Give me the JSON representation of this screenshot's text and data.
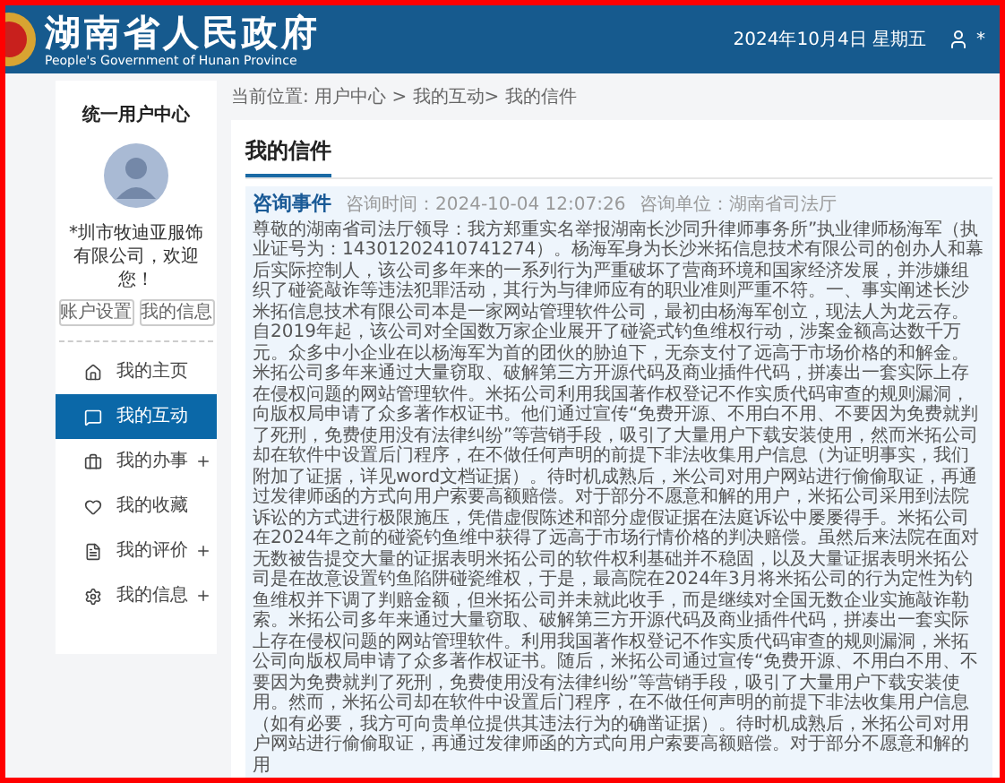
{
  "header": {
    "title": "湖南省人民政府",
    "subtitle": "People's Government of Hunan Province",
    "date": "2024年10月4日 星期五",
    "user": "*"
  },
  "sidebar": {
    "title": "统一用户中心",
    "welcome": "*圳市牧迪亚服饰有限公司，欢迎您！",
    "buttons": [
      "账户设置",
      "我的信息"
    ],
    "items": [
      {
        "label": "我的主页",
        "selected": false,
        "expandable": false
      },
      {
        "label": "我的互动",
        "selected": true,
        "expandable": false
      },
      {
        "label": "我的办事",
        "selected": false,
        "expandable": true
      },
      {
        "label": "我的收藏",
        "selected": false,
        "expandable": false
      },
      {
        "label": "我的评价",
        "selected": false,
        "expandable": true
      },
      {
        "label": "我的信息",
        "selected": false,
        "expandable": true
      }
    ]
  },
  "breadcrumb": "当前位置: 用户中心 > 我的互动> 我的信件",
  "card": {
    "title": "我的信件",
    "letter": {
      "type": "咨询事件",
      "time": "咨询时间：2024-10-04 12:07:26",
      "unit": "咨询单位：湖南省司法厅",
      "body": "尊敬的湖南省司法厅领导：我方郑重实名举报湖南长沙同升律师事务所”执业律师杨海军（执业证号为：14301202410741274）。杨海军身为长沙米拓信息技术有限公司的创办人和幕后实际控制人，该公司多年来的一系列行为严重破坏了营商环境和国家经济发展，并涉嫌组织了碰瓷敲诈等违法犯罪活动，其行为与律师应有的职业准则严重不符。一、事实阐述长沙米拓信息技术有限公司本是一家网站管理软件公司，最初由杨海军创立，现法人为龙云存。自2019年起，该公司对全国数万家企业展开了碰瓷式钓鱼维权行动，涉案金额高达数千万元。众多中小企业在以杨海军为首的团伙的胁迫下，无奈支付了远高于市场价格的和解金。米拓公司多年来通过大量窃取、破解第三方开源代码及商业插件代码，拼凑出一套实际上存在侵权问题的网站管理软件。米拓公司利用我国著作权登记不作实质代码审查的规则漏洞，向版权局申请了众多著作权证书。他们通过宣传“免费开源、不用白不用、不要因为免费就判了死刑，免费使用没有法律纠纷”等营销手段，吸引了大量用户下载安装使用，然而米拓公司却在软件中设置后门程序，在不做任何声明的前提下非法收集用户信息（为证明事实，我们附加了证据，详见word文档证据）。待时机成熟后，米公司对用户网站进行偷偷取证，再通过发律师函的方式向用户索要高额赔偿。对于部分不愿意和解的用户，米拓公司采用到法院诉讼的方式进行极限施压，凭借虚假陈述和部分虚假证据在法庭诉讼中屡屡得手。米拓公司在2024年之前的碰瓷钓鱼维中获得了远高于市场行情价格的判决赔偿。虽然后来法院在面对无数被告提交大量的证据表明米拓公司的软件权利基础并不稳固，以及大量证据表明米拓公司是在故意设置钓鱼陷阱碰瓷维权，于是，最高院在2024年3月将米拓公司的行为定性为钓鱼维权并下调了判赔金额，但米拓公司并未就此收手，而是继续对全国无数企业实施敲诈勒索。米拓公司多年来通过大量窃取、破解第三方开源代码及商业插件代码，拼凑出一套实际上存在侵权问题的网站管理软件。利用我国著作权登记不作实质代码审查的规则漏洞，米拓公司向版权局申请了众多著作权证书。随后，米拓公司通过宣传“免费开源、不用白不用、不要因为免费就判了死刑，免费使用没有法律纠纷”等营销手段，吸引了大量用户下载安装使用。然而，米拓公司却在软件中设置后门程序，在不做任何声明的前提下非法收集用户信息（如有必要，我方可向贵单位提供其违法行为的确凿证据）。待时机成熟后，米拓公司对用户网站进行偷偷取证，再通过发律师函的方式向用户索要高额赔偿。对于部分不愿意和解的用"
    }
  }
}
